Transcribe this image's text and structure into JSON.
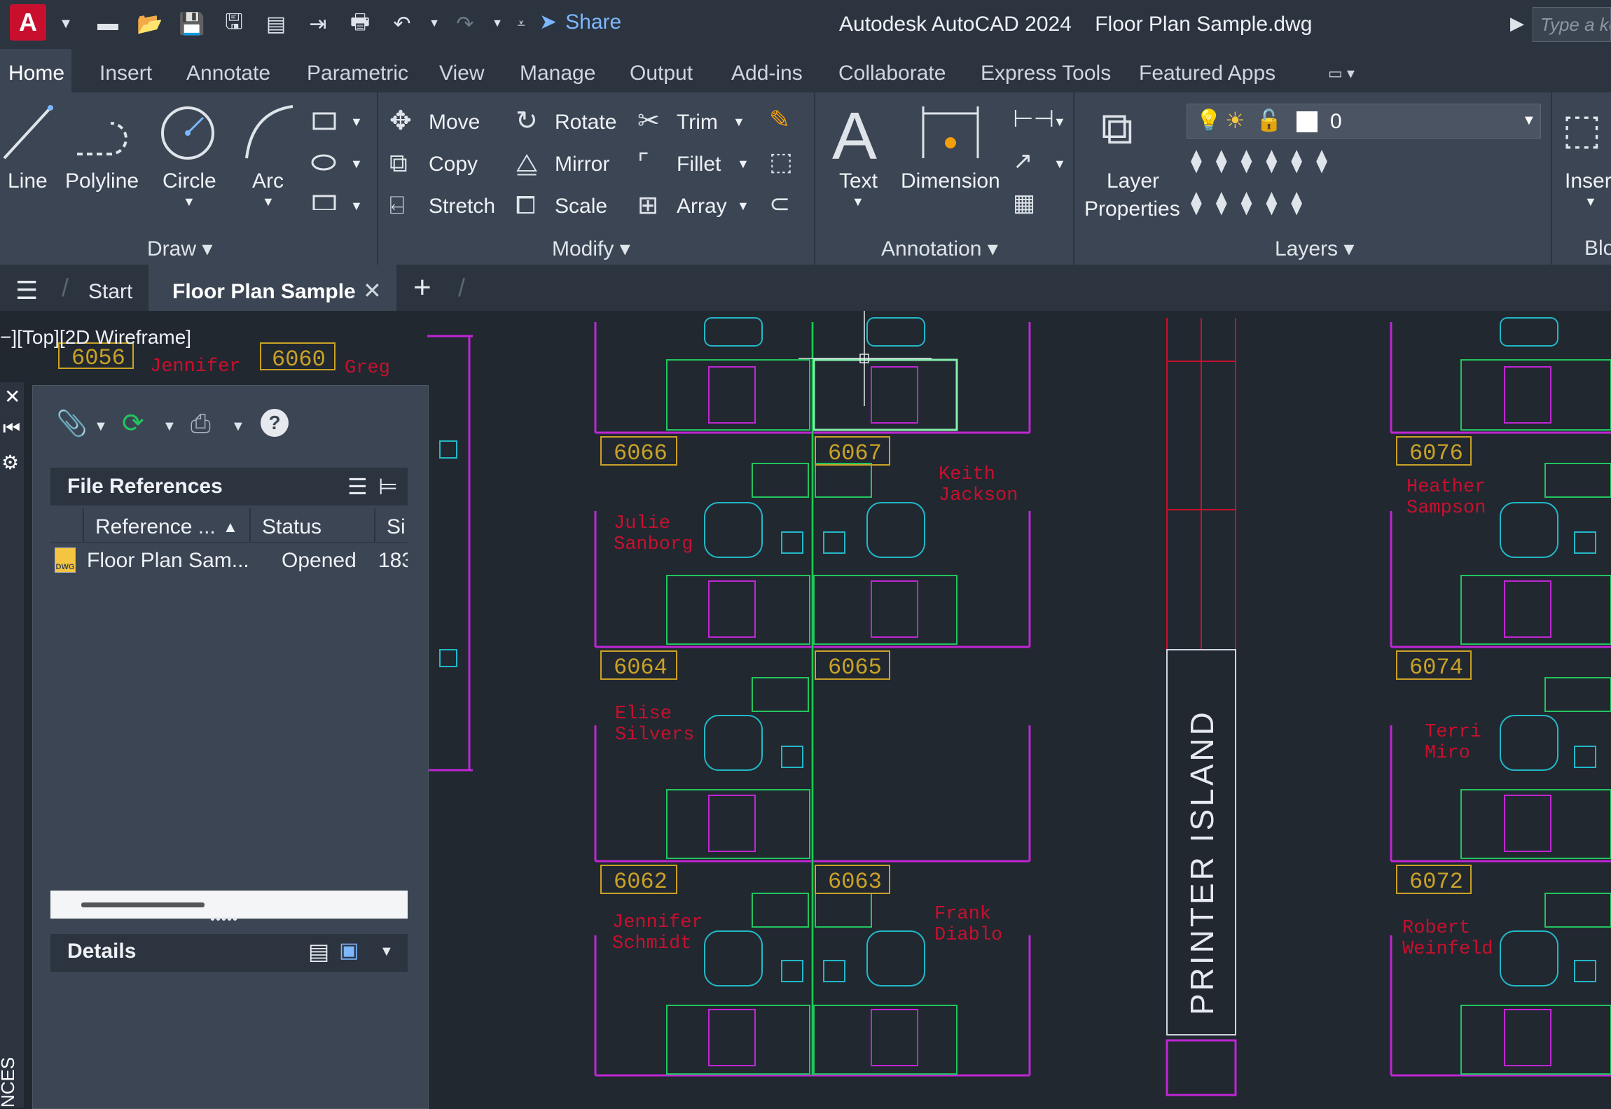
{
  "titlebar": {
    "logo_letter": "A",
    "share_label": "Share",
    "app_title": "Autodesk AutoCAD 2024",
    "file_title": "Floor Plan Sample.dwg",
    "search_placeholder": "Type a ke",
    "quick_access_icons": [
      "new-icon",
      "open-icon",
      "save-icon",
      "save-as-icon",
      "open-from-web-icon",
      "save-to-web-icon",
      "plot-icon",
      "undo-icon",
      "redo-icon",
      "customize-icon"
    ]
  },
  "ribbon_tabs": [
    "Home",
    "Insert",
    "Annotate",
    "Parametric",
    "View",
    "Manage",
    "Output",
    "Add-ins",
    "Collaborate",
    "Express Tools",
    "Featured Apps"
  ],
  "ribbon": {
    "draw": {
      "title": "Draw",
      "line": "Line",
      "polyline": "Polyline",
      "circle": "Circle",
      "arc": "Arc"
    },
    "modify": {
      "title": "Modify",
      "move": "Move",
      "copy": "Copy",
      "stretch": "Stretch",
      "rotate": "Rotate",
      "mirror": "Mirror",
      "scale": "Scale",
      "trim": "Trim",
      "fillet": "Fillet",
      "array": "Array"
    },
    "annotation": {
      "title": "Annotation",
      "text": "Text",
      "dimension": "Dimension"
    },
    "layers": {
      "title": "Layers",
      "layer_properties_1": "Layer",
      "layer_properties_2": "Properties",
      "current_layer": "0"
    },
    "block": {
      "insert": "Inser",
      "title": "Blo"
    }
  },
  "doc_tabs": {
    "start": "Start",
    "active": "Floor Plan Sample"
  },
  "viewport": {
    "label": "−][Top][2D Wireframe]"
  },
  "palette": {
    "side_label": "NCES",
    "file_references_title": "File References",
    "columns": [
      "Reference ...",
      "Status",
      "Si"
    ],
    "rows": [
      {
        "name": "Floor Plan Sam...",
        "status": "Opened",
        "size": "183"
      }
    ],
    "details_title": "Details"
  },
  "floorplan": {
    "rooms": [
      "6056",
      "6060",
      "6066",
      "6067",
      "6076",
      "6064",
      "6065",
      "6074",
      "6062",
      "6063",
      "6072"
    ],
    "people": {
      "jennifer_top": "Jennifer",
      "greg": "Greg",
      "keith_1": "Keith",
      "keith_2": "Jackson",
      "julie_1": "Julie",
      "julie_2": "Sanborg",
      "heather_1": "Heather",
      "heather_2": "Sampson",
      "elise_1": "Elise",
      "elise_2": "Silvers",
      "terri_1": "Terri",
      "terri_2": "Miro",
      "jennifer_1": "Jennifer",
      "jennifer_2": "Schmidt",
      "frank_1": "Frank",
      "frank_2": "Diablo",
      "robert_1": "Robert",
      "robert_2": "Weinfeld"
    },
    "printer_island": "PRINTER ISLAND"
  },
  "colors": {
    "accent": "#7cb7ff",
    "wall": "#c026d3",
    "furniture": "#22b8c8",
    "desk": "#22c55e",
    "room_tag": "#c9a227",
    "person_name": "#c8102e"
  }
}
